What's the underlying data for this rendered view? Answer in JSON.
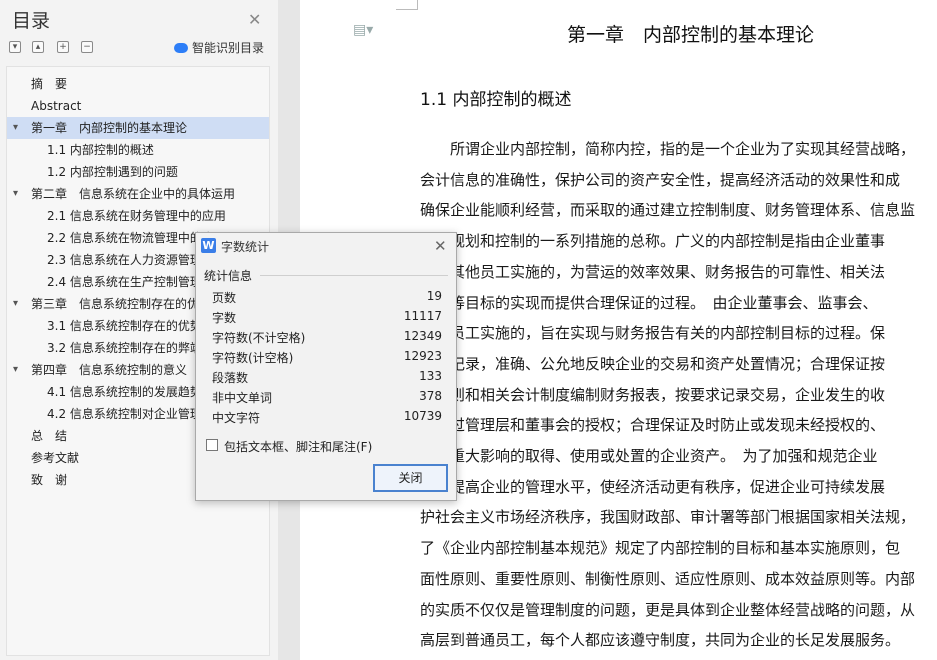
{
  "toc": {
    "title": "目录",
    "smart_label": "智能识别目录",
    "tool_icons": [
      "collapse-all-icon",
      "expand-all-icon",
      "plus-icon",
      "minus-icon"
    ],
    "items": [
      {
        "text": "摘　要",
        "level": 1,
        "expanded": null,
        "selected": false
      },
      {
        "text": "Abstract",
        "level": 1,
        "expanded": null,
        "selected": false
      },
      {
        "text": "第一章　内部控制的基本理论",
        "level": 1,
        "expanded": true,
        "selected": true
      },
      {
        "text": "1.1  内部控制的概述",
        "level": 2,
        "expanded": null,
        "selected": false
      },
      {
        "text": "1.2  内部控制遇到的问题",
        "level": 2,
        "expanded": null,
        "selected": false
      },
      {
        "text": "第二章　信息系统在企业中的具体运用",
        "level": 1,
        "expanded": true,
        "selected": false
      },
      {
        "text": "2.1  信息系统在财务管理中的应用",
        "level": 2,
        "expanded": null,
        "selected": false
      },
      {
        "text": "2.2  信息系统在物流管理中的应用",
        "level": 2,
        "expanded": null,
        "selected": false
      },
      {
        "text": "2.3  信息系统在人力资源管理中的应用",
        "level": 2,
        "expanded": null,
        "selected": false
      },
      {
        "text": "2.4  信息系统在生产控制管理中的应用",
        "level": 2,
        "expanded": null,
        "selected": false
      },
      {
        "text": "第三章　信息系统控制存在的优缺点",
        "level": 1,
        "expanded": true,
        "selected": false
      },
      {
        "text": "3.1  信息系统控制存在的优势",
        "level": 2,
        "expanded": null,
        "selected": false
      },
      {
        "text": "3.2  信息系统控制存在的弊端",
        "level": 2,
        "expanded": null,
        "selected": false
      },
      {
        "text": "第四章　信息系统控制的意义",
        "level": 1,
        "expanded": true,
        "selected": false
      },
      {
        "text": "4.1  信息系统控制的发展趋势",
        "level": 2,
        "expanded": null,
        "selected": false
      },
      {
        "text": "4.2  信息系统控制对企业管理的意义",
        "level": 2,
        "expanded": null,
        "selected": false
      },
      {
        "text": "总　结",
        "level": 1,
        "expanded": null,
        "selected": false
      },
      {
        "text": "参考文献",
        "level": 1,
        "expanded": null,
        "selected": false
      },
      {
        "text": "致　谢",
        "level": 1,
        "expanded": null,
        "selected": false
      }
    ]
  },
  "document": {
    "chapter_title": "第一章　内部控制的基本理论",
    "section_title": "1.1  内部控制的概述",
    "lines": [
      "　　所谓企业内部控制，简称内控，指的是一个企业为了实现其经营战略，",
      "会计信息的准确性，保护公司的资产安全性，提高经济活动的效果性和成",
      "确保企业能顺利经营，而采取的通过建立控制制度、财务管理体系、信息监",
      "进行规划和控制的一系列措施的总称。广义的内部控制是指由企业董事",
      "层和其他员工实施的，为营运的效率效果、财务报告的可靠性、相关法",
      "遵守等目标的实现而提供合理保证的过程。　由企业董事会、监事会、",
      "全体员工实施的，旨在实现与财务报告有关的内部控制目标的过程。保",
      "细的记录，准确、公允地反映企业的交易和资产处置情况；合理保证按",
      "计准则和相关会计制度编制财务报表，按要求记录交易，企业发生的收",
      "已经过管理层和董事会的授权；合理保证及时防止或发现未经授权的、",
      "表有重大影响的取得、使用或处置的企业资产。　为了加强和规范企业",
      "制，提高企业的管理水平，使经济活动更有秩序，促进企业可持续发展",
      "护社会主义市场经济秩序，我国财政部、审计署等部门根据国家相关法规，",
      "了《企业内部控制基本规范》规定了内部控制的目标和基本实施原则，包",
      "面性原则、重要性原则、制衡性原则、适应性原则、成本效益原则等。内部",
      "的实质不仅仅是管理制度的问题，更是具体到企业整体经营战略的问题，从",
      "高层到普通员工，每个人都应该遵守制度，共同为企业的长足发展服务。"
    ]
  },
  "word_count": {
    "icon_letter": "W",
    "title": "字数统计",
    "group_label": "统计信息",
    "stats": [
      {
        "label": "页数",
        "value": "19"
      },
      {
        "label": "字数",
        "value": "11117"
      },
      {
        "label": "字符数(不计空格)",
        "value": "12349"
      },
      {
        "label": "字符数(计空格)",
        "value": "12923"
      },
      {
        "label": "段落数",
        "value": "133"
      },
      {
        "label": "非中文单词",
        "value": "378"
      },
      {
        "label": "中文字符",
        "value": "10739"
      }
    ],
    "checkbox_label": "包括文本框、脚注和尾注(F)",
    "checkbox_checked": false,
    "close_button": "关闭"
  }
}
